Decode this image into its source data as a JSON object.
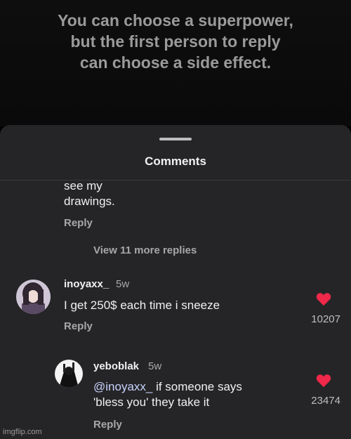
{
  "caption": {
    "line1": "You can choose a superpower,",
    "line2": "but the first person to reply",
    "line3": "can choose a side effect."
  },
  "sheet": {
    "title": "Comments"
  },
  "previous_comment": {
    "text_line1": "see my",
    "text_line2": "drawings.",
    "reply_label": "Reply",
    "view_more_label": "View 11 more replies"
  },
  "comments": [
    {
      "username": "inoyaxx_",
      "time": "5w",
      "text": "I get 250$ each time i sneeze",
      "reply_label": "Reply",
      "likes": "10207"
    },
    {
      "username": "yeboblak",
      "time": "5w",
      "mention": "@inoyaxx_",
      "text_after_mention": " if someone says",
      "text_line2": "'bless you' they take it",
      "reply_label": "Reply",
      "likes": "23474"
    }
  ],
  "colors": {
    "heart": "#f0284a",
    "sheet_bg": "#252527",
    "mention": "#c9d3ff"
  },
  "watermark": "imgflip.com"
}
